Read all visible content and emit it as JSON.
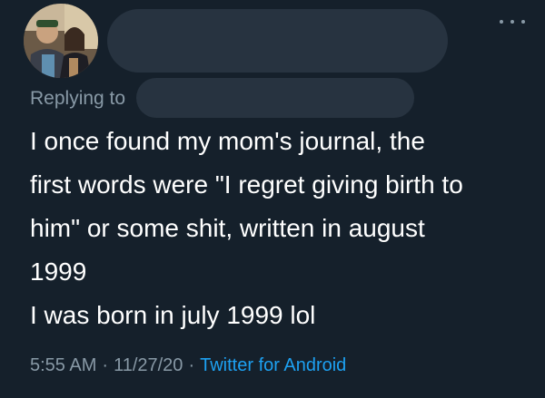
{
  "tweet": {
    "reply_label": "Replying to",
    "lines": [
      "I once found my mom's journal, the",
      "first words were \"I regret giving birth to",
      "him\" or some shit, written in august",
      "1999",
      "I was born in july 1999 lol"
    ],
    "time": "5:55 AM",
    "date": "11/27/20",
    "separator": "·",
    "source": "Twitter for Android"
  },
  "icons": {
    "more": "more-horizontal-icon",
    "avatar": "avatar"
  },
  "colors": {
    "background": "#15202b",
    "text": "#ffffff",
    "muted": "#8899a6",
    "link": "#1da1f2",
    "redaction": "#273340"
  }
}
